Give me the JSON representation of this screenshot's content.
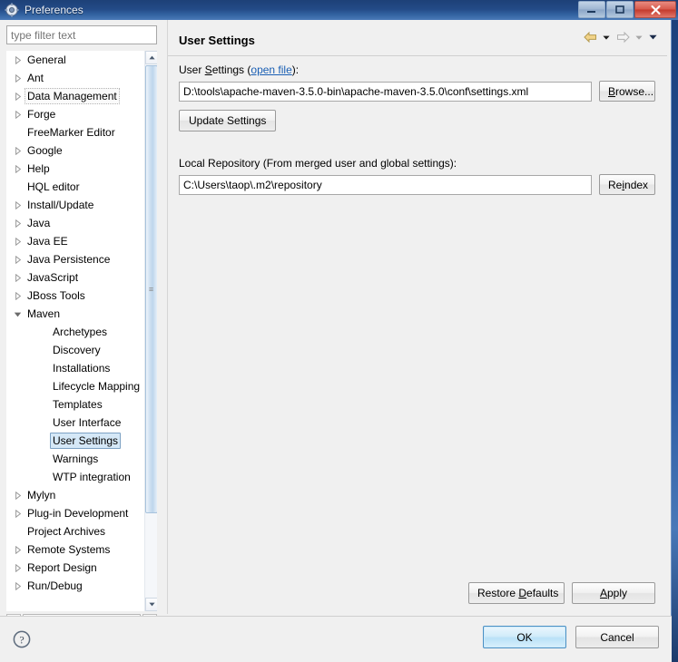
{
  "window": {
    "title": "Preferences",
    "icon": "preferences-gear-icon",
    "buttons": {
      "minimize": "minimize-icon",
      "maximize": "maximize-icon",
      "close": "close-icon"
    }
  },
  "sidebar": {
    "filter": {
      "placeholder": "type filter text",
      "value": ""
    },
    "items": [
      {
        "label": "General",
        "indent": 0,
        "expandable": true,
        "expanded": false,
        "state": "normal"
      },
      {
        "label": "Ant",
        "indent": 0,
        "expandable": true,
        "expanded": false,
        "state": "normal"
      },
      {
        "label": "Data Management",
        "indent": 0,
        "expandable": true,
        "expanded": false,
        "state": "focus"
      },
      {
        "label": "Forge",
        "indent": 0,
        "expandable": true,
        "expanded": false,
        "state": "normal"
      },
      {
        "label": "FreeMarker Editor",
        "indent": 0,
        "expandable": false,
        "expanded": false,
        "state": "normal"
      },
      {
        "label": "Google",
        "indent": 0,
        "expandable": true,
        "expanded": false,
        "state": "normal"
      },
      {
        "label": "Help",
        "indent": 0,
        "expandable": true,
        "expanded": false,
        "state": "normal"
      },
      {
        "label": "HQL editor",
        "indent": 0,
        "expandable": false,
        "expanded": false,
        "state": "normal"
      },
      {
        "label": "Install/Update",
        "indent": 0,
        "expandable": true,
        "expanded": false,
        "state": "normal"
      },
      {
        "label": "Java",
        "indent": 0,
        "expandable": true,
        "expanded": false,
        "state": "normal"
      },
      {
        "label": "Java EE",
        "indent": 0,
        "expandable": true,
        "expanded": false,
        "state": "normal"
      },
      {
        "label": "Java Persistence",
        "indent": 0,
        "expandable": true,
        "expanded": false,
        "state": "normal"
      },
      {
        "label": "JavaScript",
        "indent": 0,
        "expandable": true,
        "expanded": false,
        "state": "normal"
      },
      {
        "label": "JBoss Tools",
        "indent": 0,
        "expandable": true,
        "expanded": false,
        "state": "normal"
      },
      {
        "label": "Maven",
        "indent": 0,
        "expandable": true,
        "expanded": true,
        "state": "normal"
      },
      {
        "label": "Archetypes",
        "indent": 1,
        "expandable": false,
        "expanded": false,
        "state": "normal"
      },
      {
        "label": "Discovery",
        "indent": 1,
        "expandable": false,
        "expanded": false,
        "state": "normal"
      },
      {
        "label": "Installations",
        "indent": 1,
        "expandable": false,
        "expanded": false,
        "state": "normal"
      },
      {
        "label": "Lifecycle Mapping",
        "indent": 1,
        "expandable": false,
        "expanded": false,
        "state": "normal"
      },
      {
        "label": "Templates",
        "indent": 1,
        "expandable": false,
        "expanded": false,
        "state": "normal"
      },
      {
        "label": "User Interface",
        "indent": 1,
        "expandable": false,
        "expanded": false,
        "state": "normal"
      },
      {
        "label": "User Settings",
        "indent": 1,
        "expandable": false,
        "expanded": false,
        "state": "selected"
      },
      {
        "label": "Warnings",
        "indent": 1,
        "expandable": false,
        "expanded": false,
        "state": "normal"
      },
      {
        "label": "WTP integration",
        "indent": 1,
        "expandable": false,
        "expanded": false,
        "state": "normal"
      },
      {
        "label": "Mylyn",
        "indent": 0,
        "expandable": true,
        "expanded": false,
        "state": "normal"
      },
      {
        "label": "Plug-in Development",
        "indent": 0,
        "expandable": true,
        "expanded": false,
        "state": "normal"
      },
      {
        "label": "Project Archives",
        "indent": 0,
        "expandable": false,
        "expanded": false,
        "state": "normal"
      },
      {
        "label": "Remote Systems",
        "indent": 0,
        "expandable": true,
        "expanded": false,
        "state": "normal"
      },
      {
        "label": "Report Design",
        "indent": 0,
        "expandable": true,
        "expanded": false,
        "state": "normal"
      },
      {
        "label": "Run/Debug",
        "indent": 0,
        "expandable": true,
        "expanded": false,
        "state": "normal"
      }
    ],
    "scrollbars": {
      "vertical_up": "scroll-up-icon",
      "vertical_down": "scroll-down-icon",
      "horizontal_left": "scroll-left-icon",
      "horizontal_right": "scroll-right-icon",
      "grip": "|||"
    }
  },
  "page": {
    "title": "User Settings",
    "nav": {
      "back": "back-arrow-icon",
      "back_dropdown": "chevron-down-icon",
      "forward": "forward-arrow-icon",
      "forward_dropdown": "chevron-down-icon",
      "menu_dropdown": "chevron-down-icon"
    },
    "user_settings": {
      "label_prefix": "User ",
      "label_mnemonic": "S",
      "label_suffix": "ettings ",
      "link_open_paren": "(",
      "link_text": "open file",
      "link_close_paren": "):",
      "path_value": "D:\\tools\\apache-maven-3.5.0-bin\\apache-maven-3.5.0\\conf\\settings.xml",
      "browse_mnemonic": "B",
      "browse_rest": "rowse...",
      "update_button": "Update Settings"
    },
    "local_repository": {
      "label": "Local Repository (From merged user and global settings):",
      "path_value": "C:\\Users\\taop\\.m2\\repository",
      "reindex_prefix": "Re",
      "reindex_mnemonic": "i",
      "reindex_suffix": "ndex"
    },
    "footer_buttons": {
      "restore_prefix": "Restore ",
      "restore_mnemonic": "D",
      "restore_suffix": "efaults",
      "apply_mnemonic": "A",
      "apply_suffix": "pply"
    }
  },
  "dialog_footer": {
    "help_icon": "help-question-icon",
    "ok": "OK",
    "cancel": "Cancel"
  },
  "colors": {
    "title_bar": "#234a86",
    "selection": "#d5e8f7",
    "selection_border": "#7da2c4",
    "link": "#1a5fb4",
    "primary_button_border": "#4a90c4",
    "close_button": "#c3392c",
    "back_arrow": "#f2d48a",
    "dialog_bg": "#f0f0f0"
  }
}
